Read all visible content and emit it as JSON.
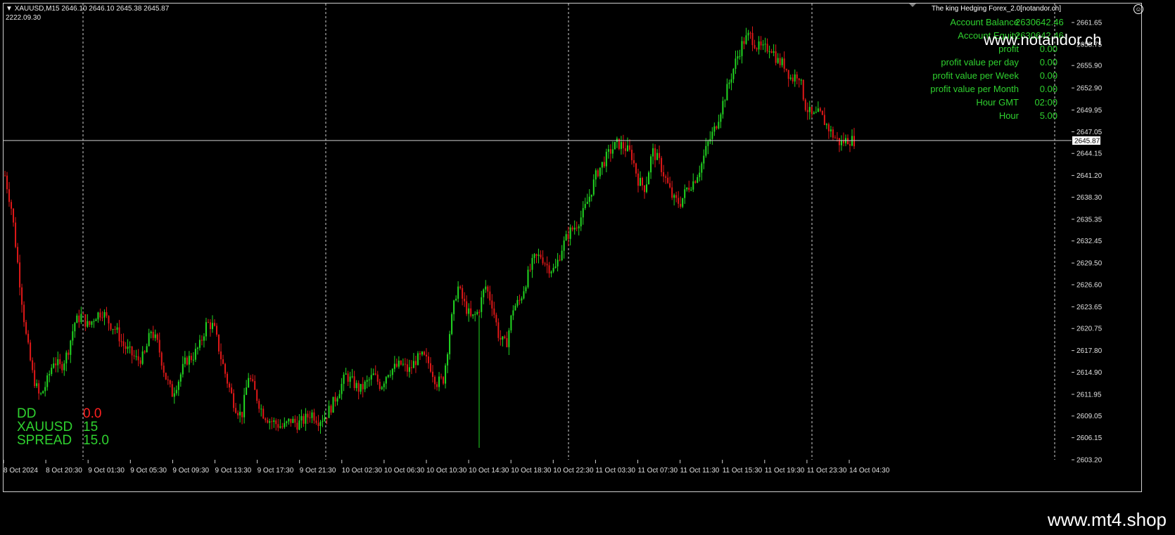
{
  "header": {
    "symbol_timeframe": "XAUUSD,M15",
    "ohlc": "2646.10 2646.10 2645.38 2645.87",
    "sub_value": "2222.09.30"
  },
  "indicator_panel": {
    "title": "The king Hedging Forex_2.0[notandor.ch]",
    "rows": [
      {
        "label": "Account Balance",
        "value": "2630642.46"
      },
      {
        "label": "Account Equity",
        "value": "2630642.46"
      },
      {
        "label": "profit",
        "value": "0.00"
      },
      {
        "label": "profit value per day",
        "value": "0.00"
      },
      {
        "label": "profit value per Week",
        "value": "0.00"
      },
      {
        "label": "profit value per Month",
        "value": "0.00"
      },
      {
        "label": "Hour GMT",
        "value": "02:00"
      },
      {
        "label": "Hour",
        "value": "5.00"
      }
    ]
  },
  "watermarks": {
    "top": "www.notandor.ch",
    "bottom": "www.mt4.shop"
  },
  "corner_info": [
    {
      "label": "DD",
      "value": "0.0",
      "value_color": "#ff2020"
    },
    {
      "label": "XAUUSD",
      "value": "15",
      "value_color": "#2fd12f"
    },
    {
      "label": "SPREAD",
      "value": "15.0",
      "value_color": "#2fd12f"
    }
  ],
  "colors": {
    "bull": "#22d822",
    "bear": "#e01818",
    "panel_text": "#2fd12f",
    "grid": "#cfcfcf"
  },
  "chart_data": {
    "type": "candlestick",
    "symbol": "XAUUSD",
    "timeframe": "M15",
    "current_price": 2645.87,
    "y_ticks": [
      "2661.65",
      "2658.75",
      "2655.90",
      "2652.90",
      "2649.95",
      "2647.05",
      "2644.15",
      "2641.20",
      "2638.30",
      "2635.35",
      "2632.45",
      "2629.50",
      "2626.60",
      "2623.65",
      "2620.75",
      "2617.80",
      "2614.90",
      "2611.95",
      "2609.05",
      "2606.15",
      "2603.20"
    ],
    "ylim": [
      2603.2,
      2661.65
    ],
    "x_ticks": [
      "8 Oct 2024",
      "8 Oct 20:30",
      "9 Oct 01:30",
      "9 Oct 05:30",
      "9 Oct 09:30",
      "9 Oct 13:30",
      "9 Oct 17:30",
      "9 Oct 21:30",
      "10 Oct 02:30",
      "10 Oct 06:30",
      "10 Oct 10:30",
      "10 Oct 14:30",
      "10 Oct 18:30",
      "10 Oct 22:30",
      "11 Oct 03:30",
      "11 Oct 07:30",
      "11 Oct 11:30",
      "11 Oct 15:30",
      "11 Oct 19:30",
      "11 Oct 23:30",
      "14 Oct 04:30"
    ],
    "price_path": [
      2641.2,
      2636.5,
      2628.0,
      2620.0,
      2614.5,
      2611.5,
      2613.5,
      2616.5,
      2615.5,
      2617.5,
      2621.5,
      2622.5,
      2621.0,
      2622.5,
      2623.0,
      2621.5,
      2620.5,
      2618.5,
      2617.5,
      2616.5,
      2617.0,
      2620.5,
      2618.5,
      2614.5,
      2612.0,
      2614.0,
      2616.5,
      2617.0,
      2618.5,
      2621.5,
      2621.0,
      2617.0,
      2613.5,
      2610.5,
      2609.0,
      2614.5,
      2612.0,
      2609.5,
      2608.5,
      2608.0,
      2607.5,
      2608.5,
      2608.0,
      2608.5,
      2609.5,
      2608.5,
      2609.0,
      2610.5,
      2612.5,
      2614.5,
      2613.5,
      2612.5,
      2613.5,
      2614.5,
      2613.0,
      2615.0,
      2615.5,
      2616.0,
      2615.0,
      2616.5,
      2617.0,
      2616.0,
      2613.5,
      2614.0,
      2621.0,
      2626.5,
      2624.0,
      2622.0,
      2623.0,
      2626.5,
      2624.0,
      2619.5,
      2618.5,
      2623.5,
      2624.5,
      2627.5,
      2630.0,
      2630.5,
      2629.0,
      2628.5,
      2631.5,
      2633.5,
      2634.5,
      2636.0,
      2638.5,
      2641.5,
      2643.0,
      2644.5,
      2645.5,
      2645.0,
      2644.0,
      2640.5,
      2639.5,
      2644.5,
      2643.0,
      2640.5,
      2638.0,
      2637.5,
      2639.5,
      2640.5,
      2642.5,
      2645.5,
      2647.5,
      2650.5,
      2653.5,
      2656.5,
      2659.0,
      2660.0,
      2658.5,
      2658.0,
      2658.5,
      2656.5,
      2656.0,
      2654.0,
      2655.0,
      2650.5,
      2649.0,
      2649.5,
      2648.0,
      2646.5,
      2645.5,
      2646.0,
      2645.87
    ]
  }
}
